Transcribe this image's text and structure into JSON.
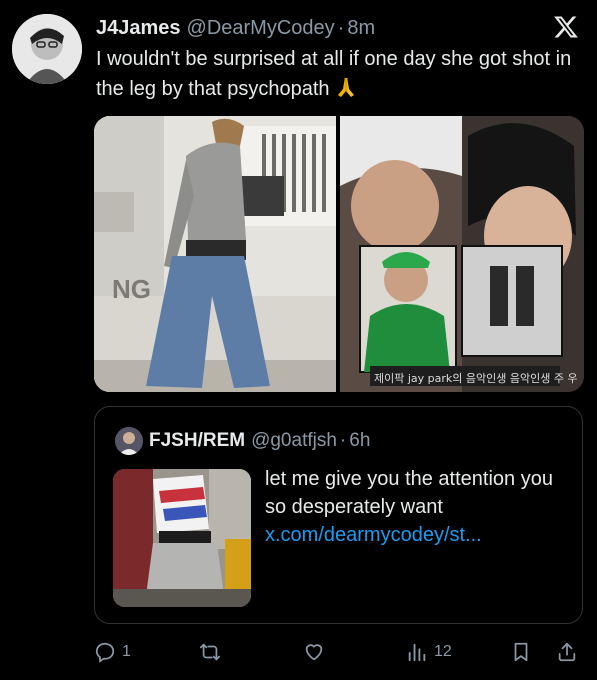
{
  "tweet": {
    "display_name": "J4James",
    "handle": "@DearMyCodey",
    "separator": "·",
    "time": "8m",
    "text": "I wouldn't be surprised at all if one day she got shot in the leg by that psychopath",
    "emoji_icon": "folded-hands-icon",
    "media": {
      "left_sign": "NG",
      "right_caption": "제이팍 jay park의 음악인생 음악인생 주 우"
    }
  },
  "quote": {
    "display_name": "FJSH/REM",
    "handle": "@g0atfjsh",
    "separator": "·",
    "time": "6h",
    "text": "let me give you the attention you so desperately want",
    "link": "x.com/dearmycodey/st..."
  },
  "actions": {
    "replies": "1",
    "reposts": "",
    "likes": "",
    "views": "12"
  },
  "colors": {
    "background": "#000000",
    "text": "#e7e9ea",
    "muted": "#8b98a5",
    "link": "#1d9bf0",
    "border": "#2f3336"
  }
}
